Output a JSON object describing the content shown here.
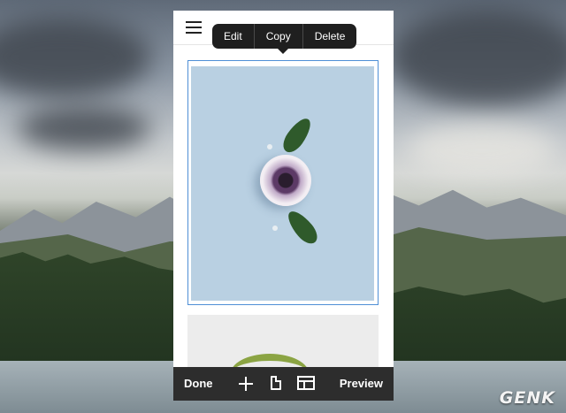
{
  "context_menu": {
    "items": [
      "Edit",
      "Copy",
      "Delete"
    ]
  },
  "bottom_bar": {
    "done_label": "Done",
    "preview_label": "Preview",
    "icons": [
      "add-icon",
      "page-icon",
      "layout-icon"
    ]
  },
  "watermark": "GENK",
  "colors": {
    "selection_border": "#4f8fd6",
    "toolbar": "#2d2d2d",
    "menu": "#1f1f1f"
  }
}
